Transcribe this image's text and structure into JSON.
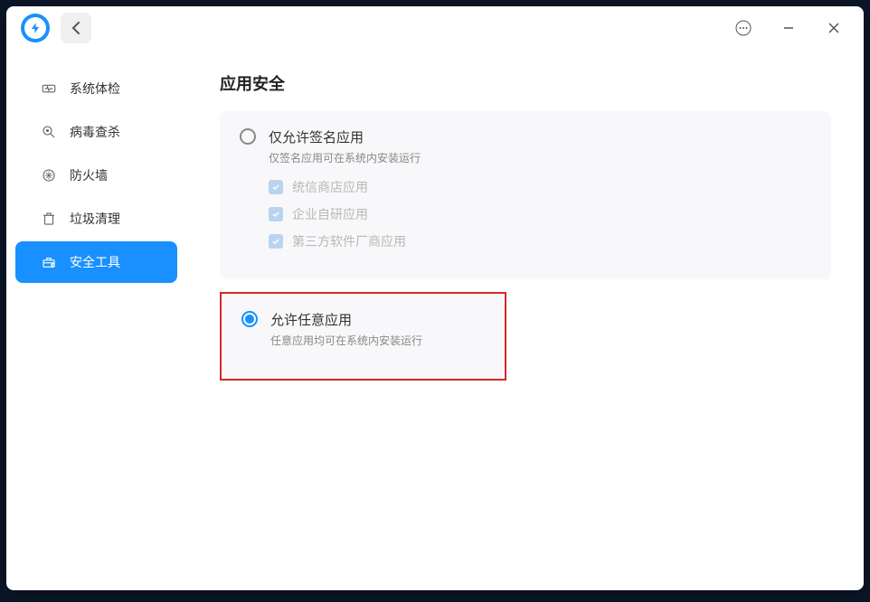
{
  "sidebar": {
    "items": [
      {
        "label": "系统体检",
        "icon": "heartbeat"
      },
      {
        "label": "病毒查杀",
        "icon": "search-virus"
      },
      {
        "label": "防火墙",
        "icon": "firewall"
      },
      {
        "label": "垃圾清理",
        "icon": "trash"
      },
      {
        "label": "安全工具",
        "icon": "toolbox"
      }
    ],
    "active_index": 4
  },
  "page": {
    "title": "应用安全"
  },
  "options": {
    "signed": {
      "title": "仅允许签名应用",
      "desc": "仅签名应用可在系统内安装运行",
      "sub": [
        "统信商店应用",
        "企业自研应用",
        "第三方软件厂商应用"
      ],
      "selected": false
    },
    "any": {
      "title": "允许任意应用",
      "desc": "任意应用均可在系统内安装运行",
      "selected": true
    }
  }
}
